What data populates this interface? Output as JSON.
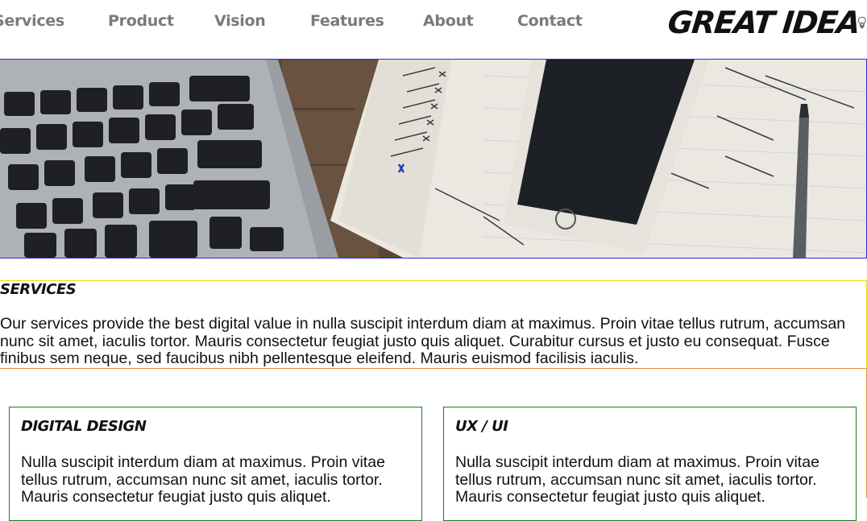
{
  "nav": {
    "links": [
      "Services",
      "Product",
      "Vision",
      "Features",
      "About",
      "Contact"
    ],
    "logo_text": "GREAT IDEA"
  },
  "services": {
    "title": "SERVICES",
    "text": "Our services provide the best digital value in nulla suscipit interdum diam at maximus. Proin vitae tellus rutrum, accumsan nunc sit amet, iaculis tortor. Mauris consectetur feugiat justo quis aliquet. Curabitur cursus et justo eu consequat. Fusce finibus sem neque, sed faucibus nibh pellentesque eleifend. Mauris euismod facilisis iaculis."
  },
  "cards": [
    {
      "title": "DIGITAL DESIGN",
      "text": "Nulla suscipit interdum diam at maximus. Proin vitae tellus rutrum, accumsan nunc sit amet, iaculis tortor. Mauris consectetur feugiat justo quis aliquet."
    },
    {
      "title": "UX / UI",
      "text": "Nulla suscipit interdum diam at maximus. Proin vitae tellus rutrum, accumsan nunc sit amet, iaculis tortor. Mauris consectetur feugiat justo quis aliquet."
    }
  ],
  "colors": {
    "nav_text": "#7a7a7a",
    "hero_border": "#2b2bd6",
    "services_border_top": "#f0e000",
    "services_border_bottom": "#e6883a",
    "card_border": "#1e7a1e"
  },
  "icons": {
    "logo_icon": "lightbulb-icon"
  }
}
